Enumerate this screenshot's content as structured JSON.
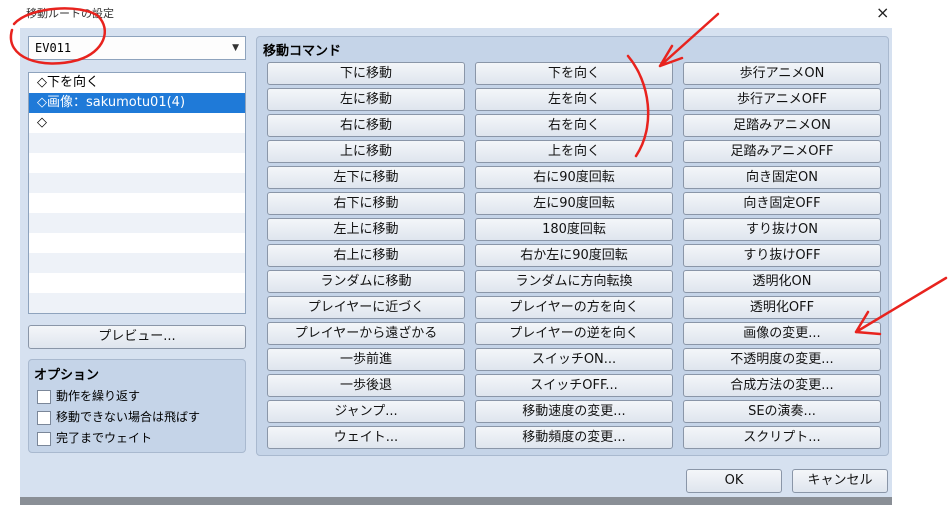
{
  "window": {
    "title": "移動ルートの設定",
    "close_glyph": "×"
  },
  "event_select": {
    "value": "EV011",
    "arrow": "▼"
  },
  "route_list": [
    "◇下を向く",
    "◇画像：sakumotu01(4)",
    "◇"
  ],
  "preview_label": "プレビュー...",
  "options": {
    "title": "オプション",
    "items": [
      "動作を繰り返す",
      "移動できない場合は飛ばす",
      "完了までウェイト"
    ]
  },
  "commands": {
    "title": "移動コマンド",
    "col1": [
      "下に移動",
      "左に移動",
      "右に移動",
      "上に移動",
      "左下に移動",
      "右下に移動",
      "左上に移動",
      "右上に移動",
      "ランダムに移動",
      "プレイヤーに近づく",
      "プレイヤーから遠ざかる",
      "一歩前進",
      "一歩後退",
      "ジャンプ...",
      "ウェイト..."
    ],
    "col2": [
      "下を向く",
      "左を向く",
      "右を向く",
      "上を向く",
      "右に90度回転",
      "左に90度回転",
      "180度回転",
      "右か左に90度回転",
      "ランダムに方向転換",
      "プレイヤーの方を向く",
      "プレイヤーの逆を向く",
      "スイッチON...",
      "スイッチOFF...",
      "移動速度の変更...",
      "移動頻度の変更..."
    ],
    "col3": [
      "歩行アニメON",
      "歩行アニメOFF",
      "足踏みアニメON",
      "足踏みアニメOFF",
      "向き固定ON",
      "向き固定OFF",
      "すり抜けON",
      "すり抜けOFF",
      "透明化ON",
      "透明化OFF",
      "画像の変更...",
      "不透明度の変更...",
      "合成方法の変更...",
      "SEの演奏...",
      "スクリプト..."
    ]
  },
  "footer": {
    "ok": "OK",
    "cancel": "キャンセル"
  },
  "annotation_color": "#e8231e"
}
